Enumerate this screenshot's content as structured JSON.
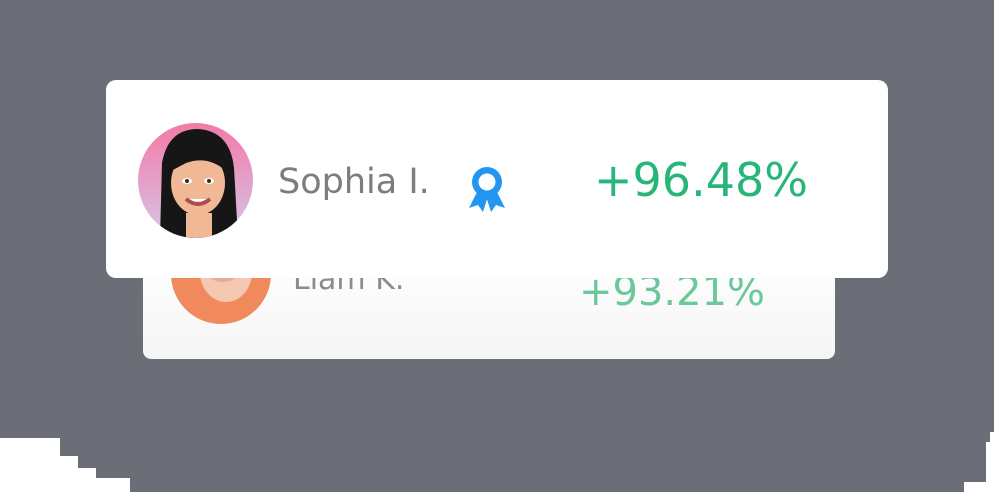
{
  "leaderboard": {
    "items": [
      {
        "name": "Sophia I.",
        "value": "+96.48%",
        "badge_icon": "award-ribbon-icon"
      },
      {
        "name": "Liam K.",
        "value": "+93.21%"
      }
    ]
  },
  "colors": {
    "background": "#6b6e76",
    "card": "#ffffff",
    "value_green": "#26b677",
    "value_green_faded": "#6ac89a",
    "badge_blue": "#2196f3",
    "name_gray": "#7d7d80"
  }
}
